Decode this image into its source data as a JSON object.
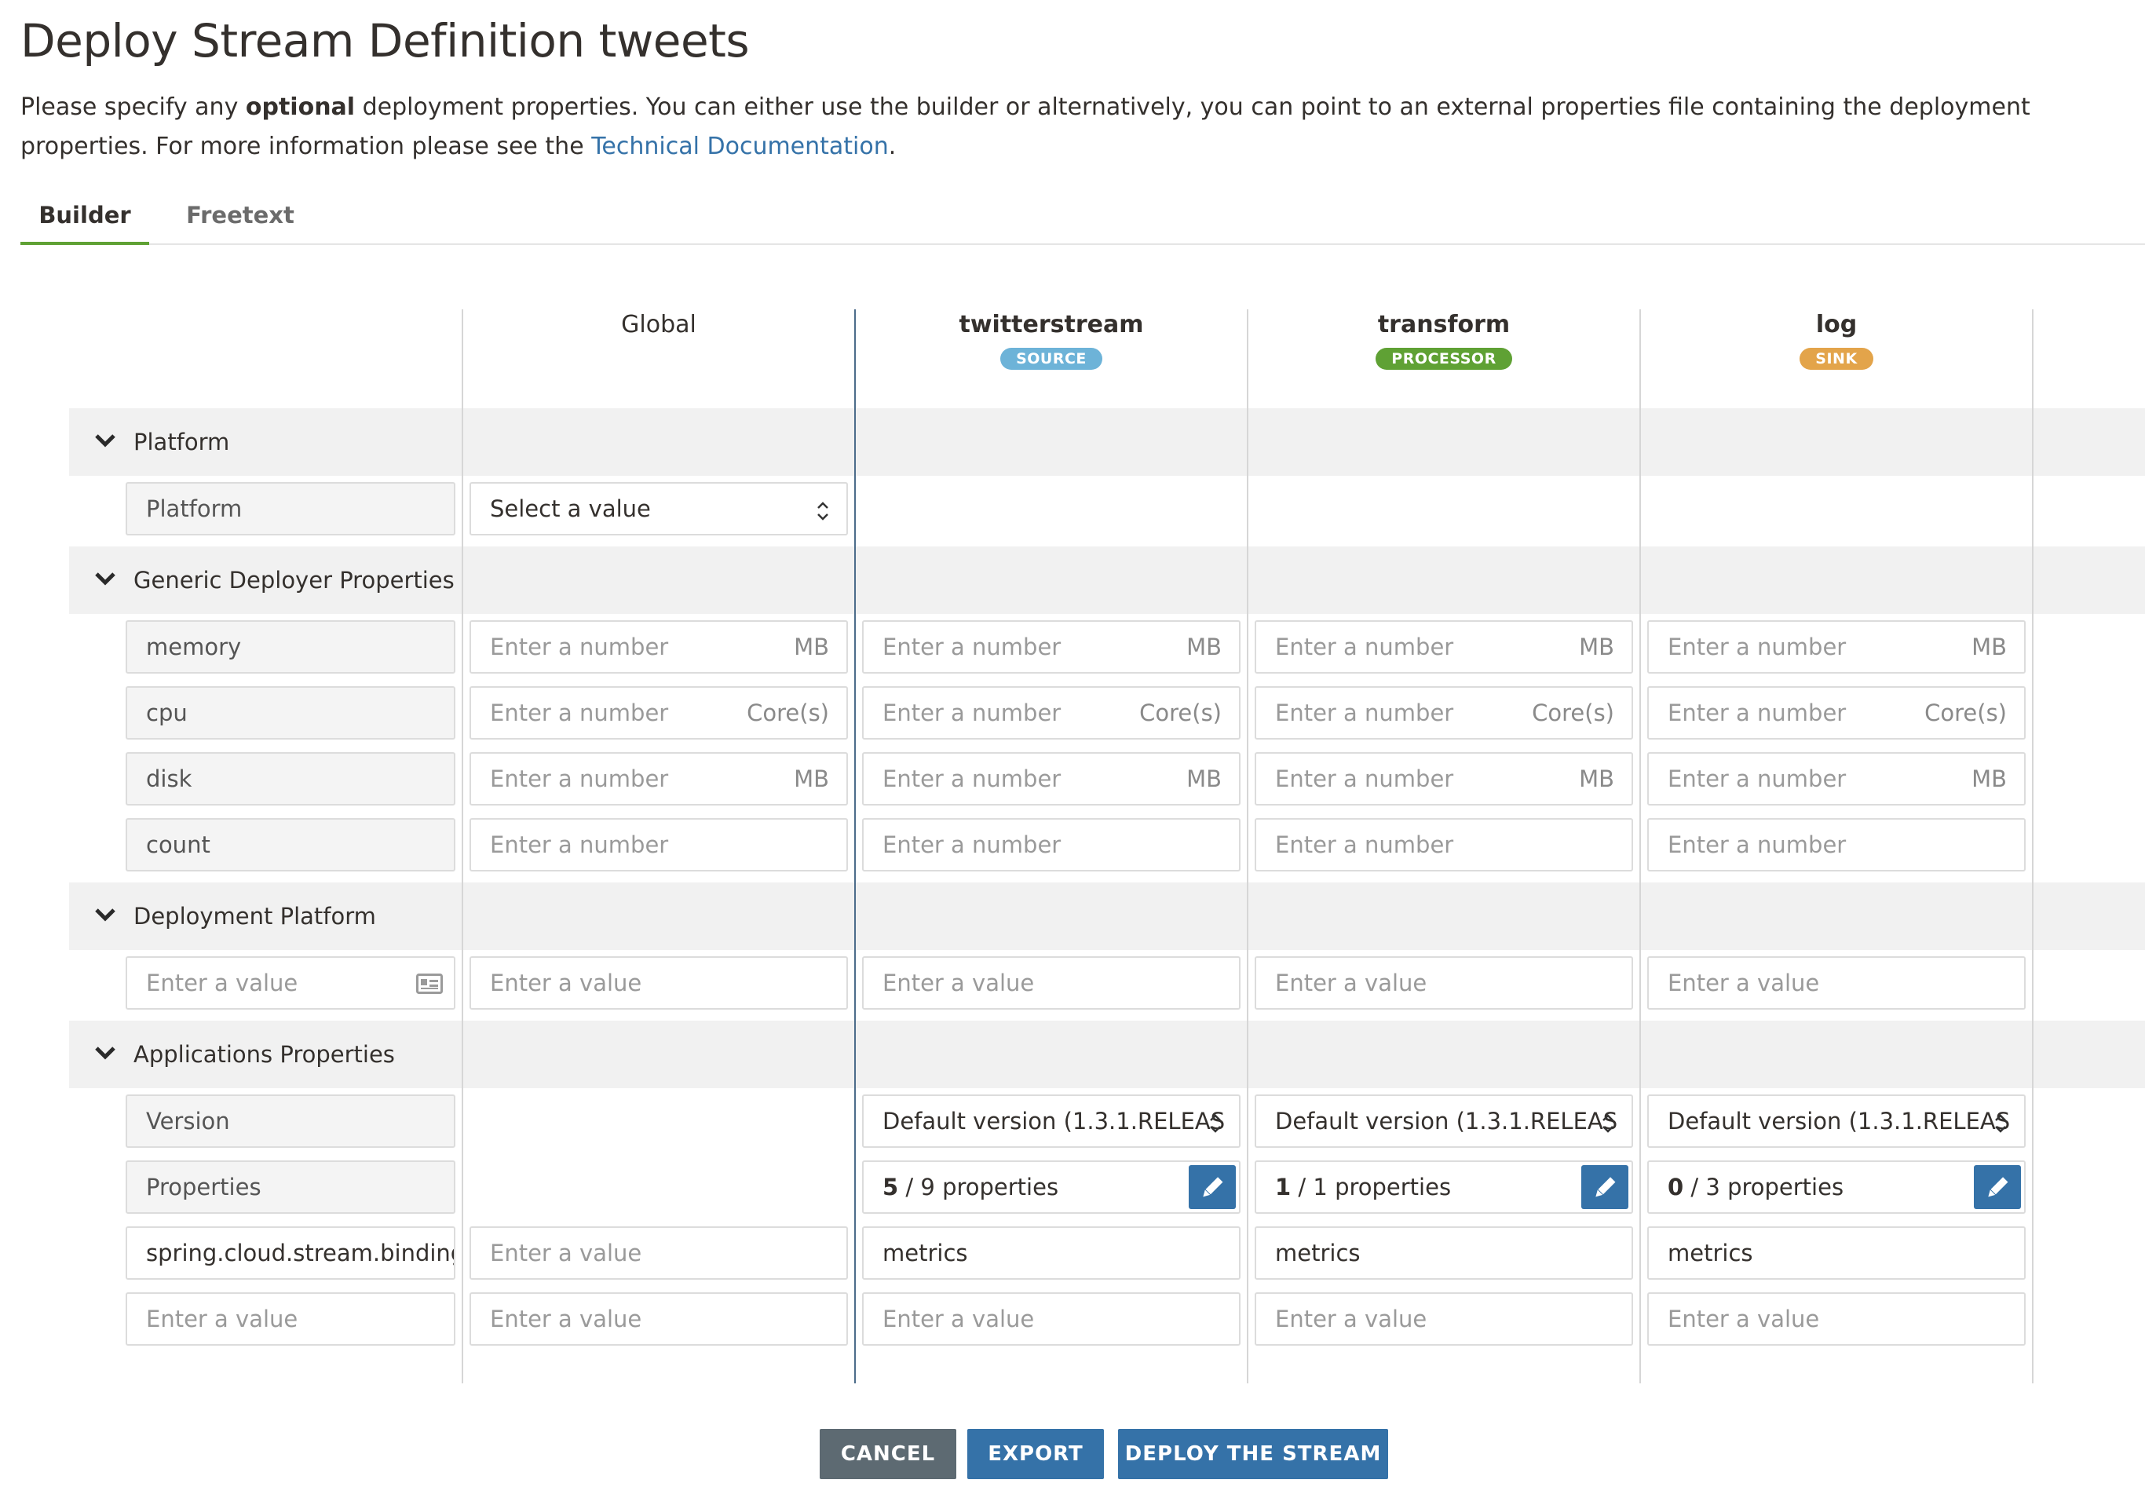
{
  "page": {
    "title": "Deploy Stream Definition tweets",
    "intro_1": "Please specify any ",
    "intro_bold": "optional",
    "intro_2": " deployment properties. You can either use the builder or alternatively, you can point to an external properties file containing the deployment properties. For more information please see the ",
    "intro_link": "Technical Documentation",
    "intro_end": "."
  },
  "tabs": {
    "builder": "Builder",
    "freetext": "Freetext"
  },
  "columns": {
    "global": "Global",
    "twitterstream": {
      "name": "twitterstream",
      "badge": "SOURCE",
      "badge_color": "#6db3d8"
    },
    "transform": {
      "name": "transform",
      "badge": "PROCESSOR",
      "badge_color": "#5fa134"
    },
    "log": {
      "name": "log",
      "badge": "SINK",
      "badge_color": "#e3a44a"
    }
  },
  "sections": {
    "platform": "Platform",
    "generic": "Generic Deployer Properties",
    "deployment_platform": "Deployment Platform",
    "app_properties": "Applications Properties"
  },
  "labels": {
    "platform": "Platform",
    "memory": "memory",
    "cpu": "cpu",
    "disk": "disk",
    "count": "count",
    "version": "Version",
    "properties": "Properties",
    "spring": "spring.cloud.stream.binding"
  },
  "placeholders": {
    "select": "Select a value",
    "number": "Enter a number",
    "value": "Enter a value"
  },
  "units": {
    "mb": "MB",
    "core": "Core(s)"
  },
  "version_value": "Default version (1.3.1.RELEAS",
  "properties_counts": {
    "twitterstream": {
      "selected": "5",
      "rest": " / 9 properties"
    },
    "transform": {
      "selected": "1",
      "rest": " / 1 properties"
    },
    "log": {
      "selected": "0",
      "rest": " / 3 properties"
    }
  },
  "metrics_value": "metrics",
  "buttons": {
    "cancel": "CANCEL",
    "export": "EXPORT",
    "deploy": "DEPLOY THE STREAM"
  },
  "colors": {
    "primary": "#3572a8",
    "cancel": "#5d6a72",
    "tab_active": "#5fa134"
  }
}
